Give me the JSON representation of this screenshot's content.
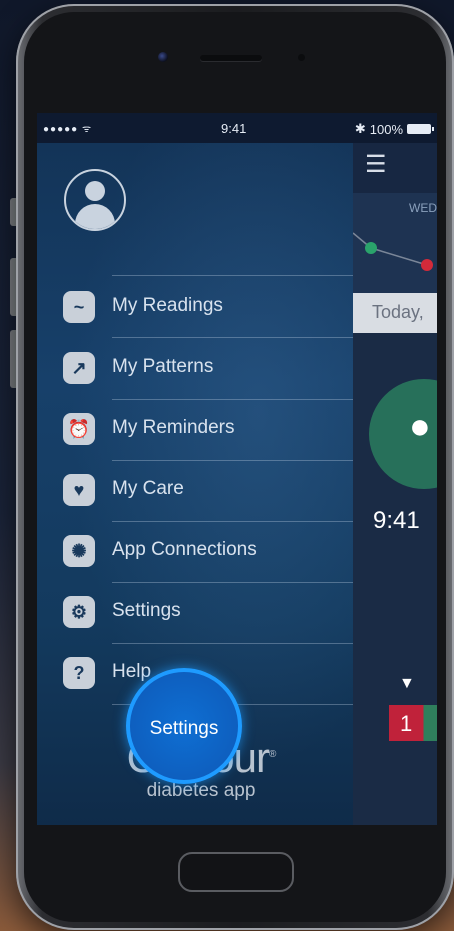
{
  "status_bar": {
    "signal": "●●●●● ᯤ",
    "time": "9:41",
    "bluetooth": "✱",
    "battery": "100%"
  },
  "main": {
    "day_header": "WED",
    "today_label": "Today,",
    "reading_time": "9:41",
    "badge_value": "1",
    "colors": {
      "meal_circle": "#27705a",
      "badge_high": "#c0223a",
      "badge_ok": "#2f7f5c"
    }
  },
  "drawer": {
    "menu_items": [
      {
        "label": "My Readings",
        "icon": "readings-icon"
      },
      {
        "label": "My Patterns",
        "icon": "patterns-icon"
      },
      {
        "label": "My Reminders",
        "icon": "reminders-icon"
      },
      {
        "label": "My Care",
        "icon": "care-icon"
      },
      {
        "label": "App Connections",
        "icon": "connections-icon"
      },
      {
        "label": "Settings",
        "icon": "gear-icon"
      },
      {
        "label": "Help",
        "icon": "help-icon"
      }
    ],
    "logo": {
      "word": "Contour",
      "trademark": "®",
      "tagline": "diabetes app"
    }
  },
  "touch": {
    "label": "Settings",
    "color": "#1e9bff"
  }
}
